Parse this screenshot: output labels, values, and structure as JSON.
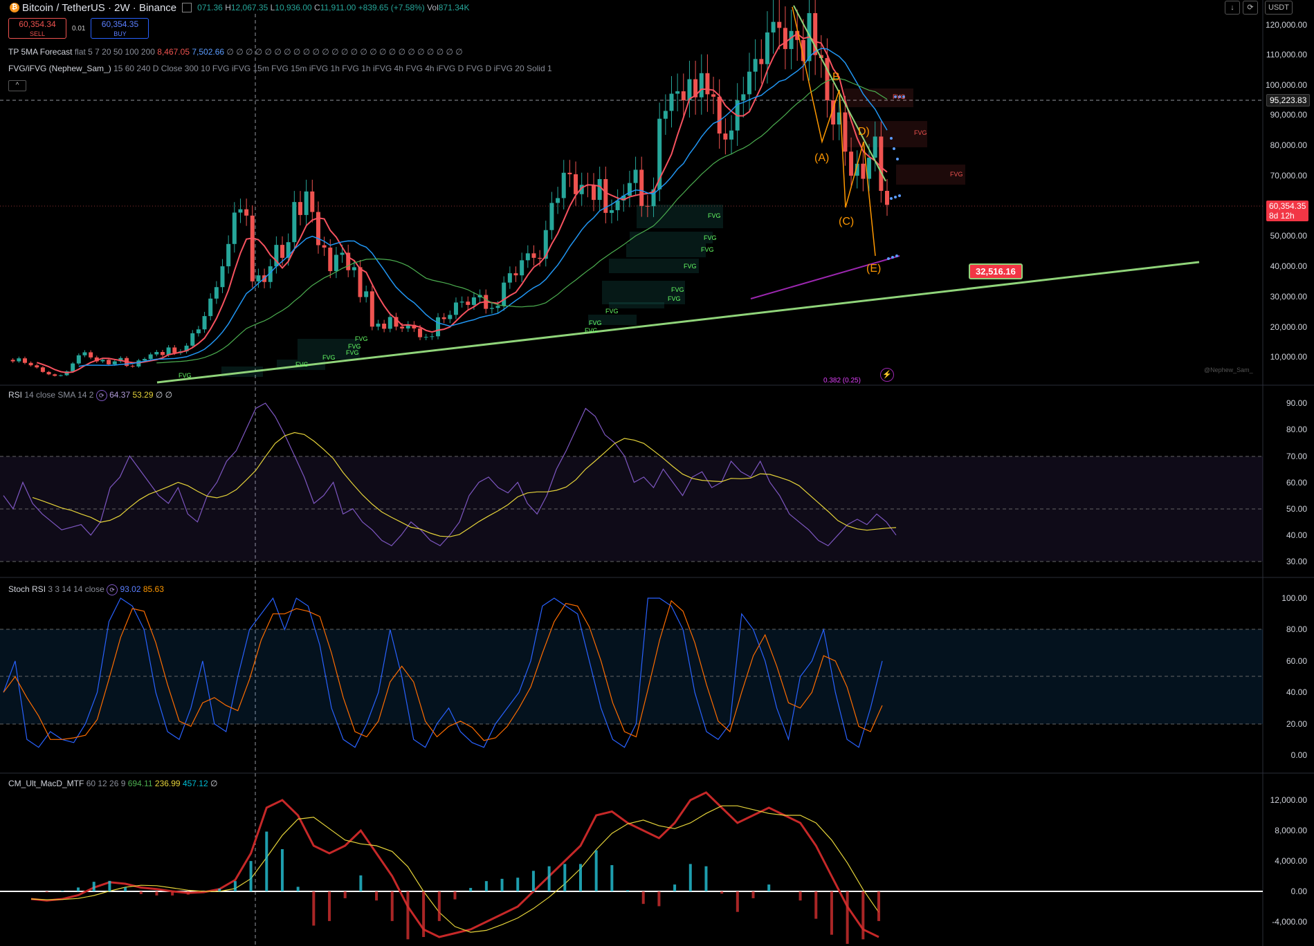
{
  "header": {
    "symbol": "Bitcoin / TetherUS · 2W · Binance",
    "open": "071.36",
    "high_label": "H",
    "high": "12,067.35",
    "low_label": "L",
    "low": "10,936.00",
    "close_label": "C",
    "close": "11,911.00",
    "change": "+839.65 (+7.58%)",
    "vol_label": "Vol",
    "vol": "871.34K",
    "currency": "USDT"
  },
  "trade": {
    "sell_price": "60,354.34",
    "sell_label": "SELL",
    "spread": "0.01",
    "buy_price": "60,354.35",
    "buy_label": "BUY"
  },
  "indicators": {
    "tp_name": "TP 5MA Forecast",
    "tp_params": "flat 5 7 20 50 100 200",
    "tp_v1": "8,467.05",
    "tp_v2": "7,502.66",
    "tp_tail": "∅ ∅ ∅ ∅ ∅ ∅ ∅ ∅ ∅ ∅ ∅ ∅ ∅ ∅ ∅ ∅ ∅ ∅ ∅ ∅ ∅ ∅ ∅ ∅ ∅",
    "fvg_name": "FVG/iFVG (Nephew_Sam_)",
    "fvg_params": "15 60 240 D Close 300 10 FVG iFVG 15m FVG 15m iFVG 1h FVG 1h iFVG 4h FVG 4h iFVG D FVG D iFVG 20 Solid 1",
    "collapse": "^"
  },
  "price_axis": [
    "120,000.00",
    "110,000.00",
    "100,000.00",
    "90,000.00",
    "80,000.00",
    "70,000.00",
    "50,000.00",
    "40,000.00",
    "30,000.00",
    "20,000.00",
    "10,000.00"
  ],
  "price_tags": {
    "crosshair": "95,223.83",
    "last": "60,354.35",
    "countdown": "8d 12h",
    "trendline": "32,516.16"
  },
  "waves": [
    "B",
    "(A)",
    "(C)",
    "D)",
    "(E)"
  ],
  "fvg_label": "FVG",
  "fib_label": "0.382 (0.25)",
  "watermark": "@Nephew_Sam_",
  "rsi": {
    "title": "RSI",
    "params": "14 close SMA 14 2",
    "v1": "64.37",
    "v2": "53.29",
    "tail": "∅ ∅",
    "axis": [
      "90.00",
      "80.00",
      "70.00",
      "60.00",
      "50.00",
      "40.00",
      "30.00"
    ]
  },
  "stoch": {
    "title": "Stoch RSI",
    "params": "3 3 14 14 close",
    "k": "93.02",
    "d": "85.63",
    "axis": [
      "100.00",
      "80.00",
      "60.00",
      "40.00",
      "20.00",
      "0.00"
    ]
  },
  "macd": {
    "title": "CM_Ult_MacD_MTF",
    "params": "60 12 26 9",
    "v1": "694.11",
    "v2": "236.99",
    "v3": "457.12",
    "tail": "∅",
    "axis": [
      "12,000.00",
      "8,000.00",
      "4,000.00",
      "0.00",
      "-4,000.00"
    ]
  },
  "colors": {
    "bull": "#26a69a",
    "bear": "#ef5350",
    "ema_red": "#f7525f",
    "ema_blue": "#2196f3",
    "ema_green": "#4caf50",
    "ema_purple": "#9c27b0",
    "trend": "#90d47a",
    "wave": "#ff9800",
    "rsi": "#7e57c2",
    "rsi_ma": "#e6d43a",
    "stoch_k": "#2962ff",
    "stoch_d": "#ff6d00"
  }
}
